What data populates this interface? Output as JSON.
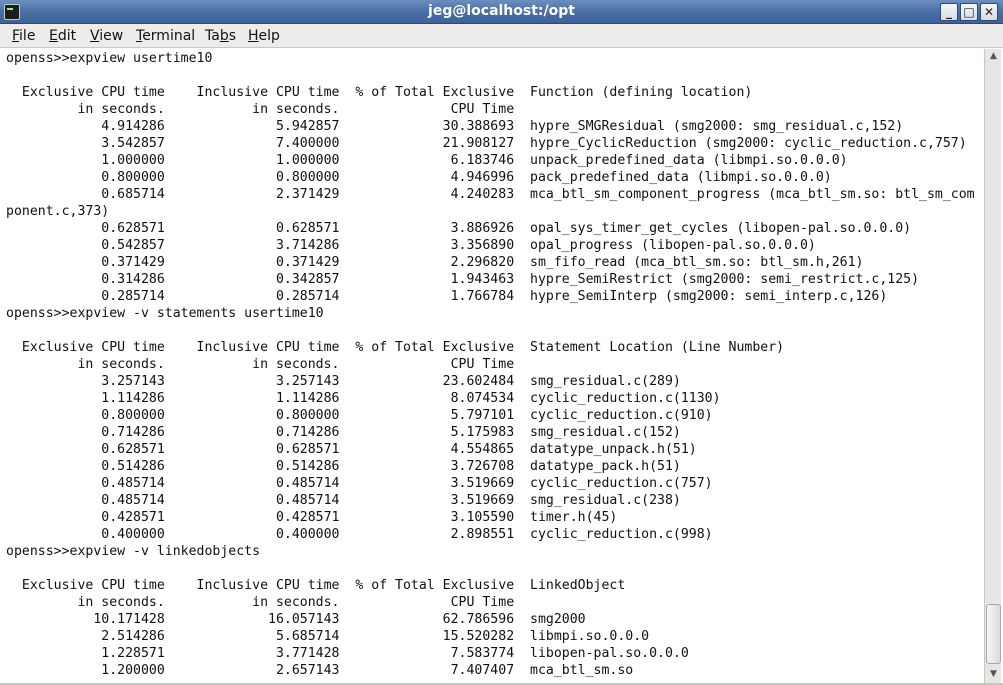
{
  "window": {
    "title": "jeg@localhost:/opt"
  },
  "menu": [
    {
      "mnemonic": "F",
      "rest": "ile"
    },
    {
      "mnemonic": "E",
      "rest": "dit"
    },
    {
      "mnemonic": "V",
      "rest": "iew"
    },
    {
      "mnemonic": "T",
      "rest": "erminal"
    },
    {
      "mnemonic": "",
      "rest": "Ta",
      "mnemonic_after": "b",
      "tail": "s"
    },
    {
      "mnemonic": "H",
      "rest": "elp"
    }
  ],
  "terminal": {
    "lines": [
      "openss>>expview usertime10",
      "",
      "  Exclusive CPU time    Inclusive CPU time  % of Total Exclusive  Function (defining location)",
      "         in seconds.           in seconds.              CPU Time",
      "            4.914286              5.942857             30.388693  hypre_SMGResidual (smg2000: smg_residual.c,152)",
      "            3.542857              7.400000             21.908127  hypre_CyclicReduction (smg2000: cyclic_reduction.c,757)",
      "            1.000000              1.000000              6.183746  unpack_predefined_data (libmpi.so.0.0.0)",
      "            0.800000              0.800000              4.946996  pack_predefined_data (libmpi.so.0.0.0)",
      "            0.685714              2.371429              4.240283  mca_btl_sm_component_progress (mca_btl_sm.so: btl_sm_com",
      "ponent.c,373)",
      "            0.628571              0.628571              3.886926  opal_sys_timer_get_cycles (libopen-pal.so.0.0.0)",
      "            0.542857              3.714286              3.356890  opal_progress (libopen-pal.so.0.0.0)",
      "            0.371429              0.371429              2.296820  sm_fifo_read (mca_btl_sm.so: btl_sm.h,261)",
      "            0.314286              0.342857              1.943463  hypre_SemiRestrict (smg2000: semi_restrict.c,125)",
      "            0.285714              0.285714              1.766784  hypre_SemiInterp (smg2000: semi_interp.c,126)",
      "openss>>expview -v statements usertime10",
      "",
      "  Exclusive CPU time    Inclusive CPU time  % of Total Exclusive  Statement Location (Line Number)",
      "         in seconds.           in seconds.              CPU Time",
      "            3.257143              3.257143             23.602484  smg_residual.c(289)",
      "            1.114286              1.114286              8.074534  cyclic_reduction.c(1130)",
      "            0.800000              0.800000              5.797101  cyclic_reduction.c(910)",
      "            0.714286              0.714286              5.175983  smg_residual.c(152)",
      "            0.628571              0.628571              4.554865  datatype_unpack.h(51)",
      "            0.514286              0.514286              3.726708  datatype_pack.h(51)",
      "            0.485714              0.485714              3.519669  cyclic_reduction.c(757)",
      "            0.485714              0.485714              3.519669  smg_residual.c(238)",
      "            0.428571              0.428571              3.105590  timer.h(45)",
      "            0.400000              0.400000              2.898551  cyclic_reduction.c(998)",
      "openss>>expview -v linkedobjects",
      "",
      "  Exclusive CPU time    Inclusive CPU time  % of Total Exclusive  LinkedObject",
      "         in seconds.           in seconds.              CPU Time",
      "           10.171428             16.057143             62.786596  smg2000",
      "            2.514286              5.685714             15.520282  libmpi.so.0.0.0",
      "            1.228571              3.771428              7.583774  libopen-pal.so.0.0.0",
      "            1.200000              2.657143              7.407407  mca_btl_sm.so"
    ]
  }
}
